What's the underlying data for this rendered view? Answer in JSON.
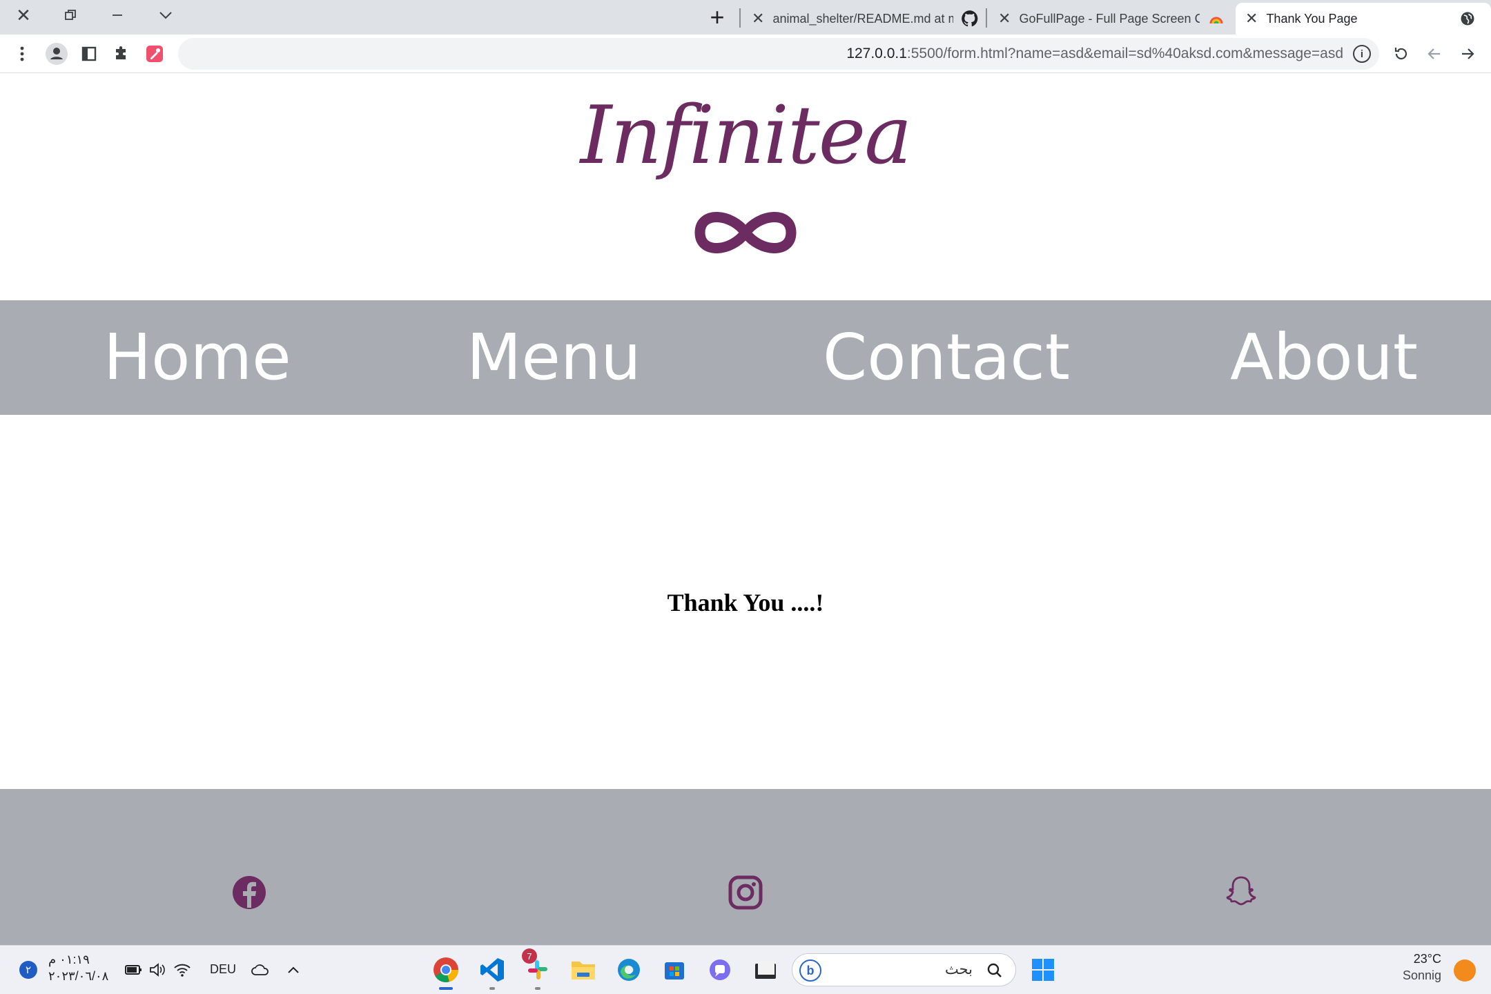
{
  "browser": {
    "tabs": [
      {
        "title": "animal_shelter/README.md at m",
        "favicon": "github-icon"
      },
      {
        "title": "GoFullPage - Full Page Screen Ca",
        "favicon": "gofullpage-icon"
      },
      {
        "title": "Thank You Page",
        "favicon": "globe-icon",
        "active": true
      }
    ],
    "url_host": "127.0.0.1",
    "url_rest": ":5500/form.html?name=asd&email=sd%40aksd.com&message=asd"
  },
  "site": {
    "logo_text": "Infinitea",
    "logo_symbol": "infinity-icon",
    "nav": [
      "Home",
      "Menu",
      "Contact",
      "About"
    ],
    "message": "Thank You ....!",
    "social": [
      "facebook-icon",
      "instagram-icon",
      "snapchat-icon"
    ],
    "brand_color": "#6d2c61",
    "nav_bg": "#aaacb4"
  },
  "taskbar": {
    "search_placeholder": "بحث",
    "language": "DEU",
    "time": "٠١:١٩ م",
    "date": "٢٠٢٣/٠٦/٠٨",
    "notification_count": "٢",
    "slack_badge": "7",
    "weather_temp": "23°C",
    "weather_desc": "Sonnig"
  }
}
